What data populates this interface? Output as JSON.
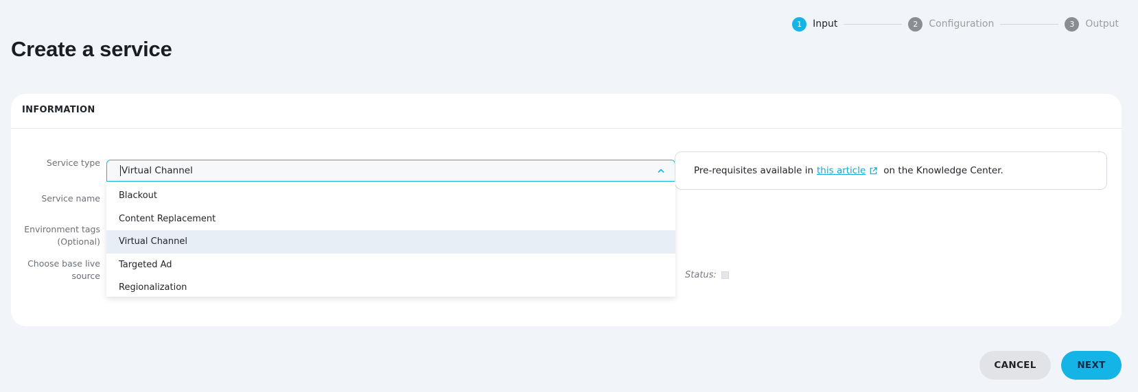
{
  "stepper": {
    "steps": [
      {
        "num": "1",
        "label": "Input"
      },
      {
        "num": "2",
        "label": "Configuration"
      },
      {
        "num": "3",
        "label": "Output"
      }
    ]
  },
  "page": {
    "title": "Create a service"
  },
  "card": {
    "header": "INFORMATION",
    "labels": {
      "service_type": "Service type",
      "service_name": "Service name",
      "env_tags_1": "Environment tags",
      "env_tags_2": "(Optional)",
      "base_source_1": "Choose base live",
      "base_source_2": "source"
    },
    "service_type": {
      "value": "Virtual Channel",
      "options": [
        "Blackout",
        "Content Replacement",
        "Virtual Channel",
        "Targeted Ad",
        "Regionalization"
      ],
      "selected_index": 2
    },
    "info": {
      "prefix": "Pre-requisites available in",
      "link": "this article",
      "suffix": "on the Knowledge Center."
    },
    "status_label": "Status:"
  },
  "actions": {
    "cancel": "CANCEL",
    "next": "NEXT"
  },
  "colors": {
    "accent": "#14b5e6",
    "background": "#f1f4f8"
  }
}
